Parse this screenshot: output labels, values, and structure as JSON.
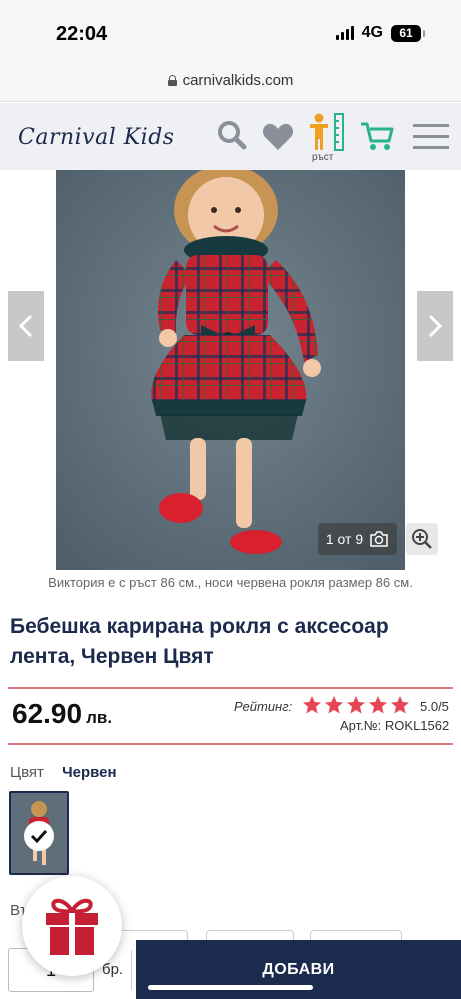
{
  "status_bar": {
    "time": "22:04",
    "network": "4G",
    "battery": "61"
  },
  "browser": {
    "url": "carnivalkids.com"
  },
  "header": {
    "logo": "Carnival Kids",
    "icons": [
      "search-icon",
      "heart-icon",
      "growth-chart-icon",
      "cart-icon",
      "menu-icon"
    ],
    "growth_label": "ръст"
  },
  "gallery": {
    "image": "product-photo",
    "counter": "1 от 9",
    "caption": "Виктория е с ръст 86 см., носи червена рокля размер 86 см."
  },
  "product": {
    "title": "Бебешка карирана рокля с аксесоар лента, Червен Цвят",
    "price": "62.90",
    "currency": "лв.",
    "rating_label": "Рейтинг:",
    "rating_stars": 5,
    "rating_value": "5.0/5",
    "article": "Арт.№: ROKL1562",
    "color_label": "Цвят",
    "color_value": "Червен",
    "size_label": "Въ… …мер"
  },
  "purchase": {
    "quantity": "1",
    "unit": "бр.",
    "add_button": "ДОБАВИ"
  },
  "colors": {
    "brand": "#1c2a4d",
    "accent": "#e64553",
    "rule": "#e3767c",
    "cart": "#28b48a",
    "growth": "#f0a020"
  }
}
